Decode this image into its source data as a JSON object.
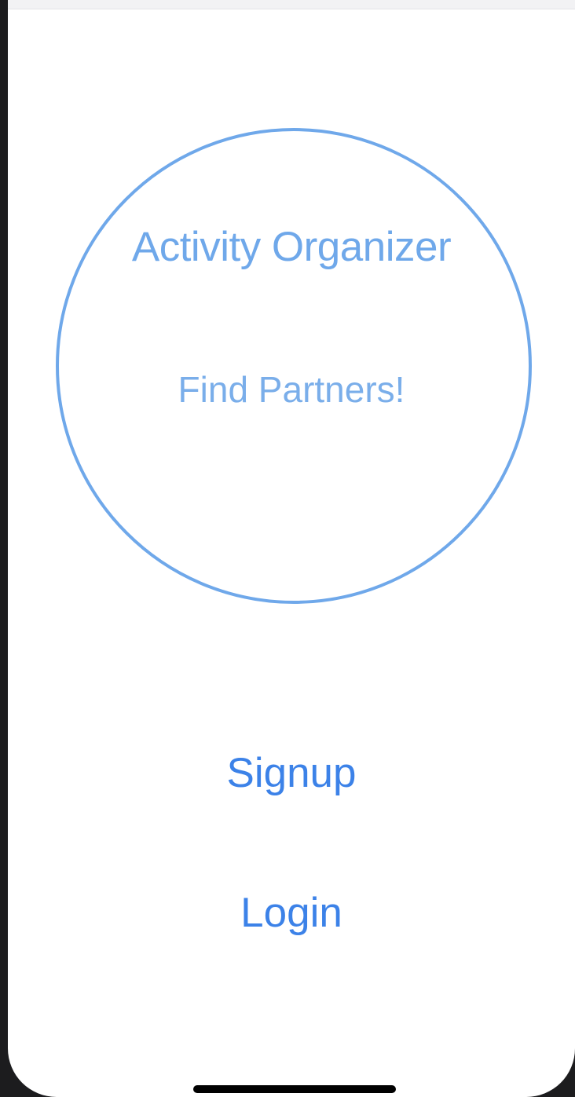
{
  "app": {
    "title": "Activity Organizer",
    "tagline": "Find Partners!"
  },
  "actions": {
    "signup_label": "Signup",
    "login_label": "Login"
  },
  "colors": {
    "circle_border": "#6fa8ea",
    "title_text": "#6fa8ea",
    "button_text": "#3c82e8",
    "background": "#ffffff"
  }
}
